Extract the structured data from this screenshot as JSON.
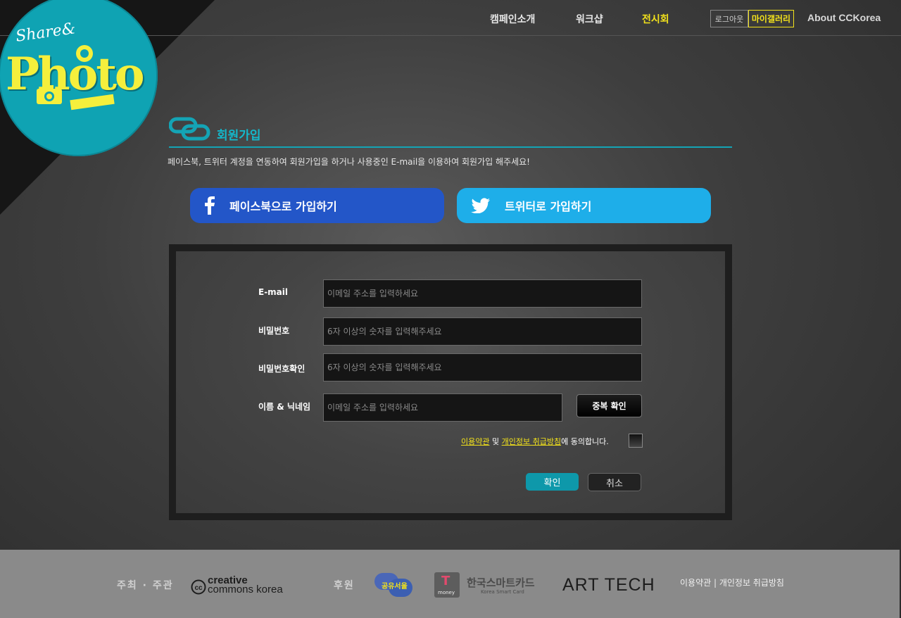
{
  "nav": {
    "items": [
      {
        "label": "캠페인소개",
        "active": false
      },
      {
        "label": "워크샵",
        "active": false
      },
      {
        "label": "전시회",
        "active": true
      }
    ],
    "logout_label": "로그아웃",
    "gallery_label": "마이갤러리",
    "about_label": "About CCKorea"
  },
  "logo": {
    "line1": "Share&",
    "line2": "Photo"
  },
  "signup": {
    "title": "회원가입",
    "intro": "페이스북, 트위터 계정을 연동하여 회원가입을 하거나 사용중인 E-mail을 이용하여 회원가입 해주세요!",
    "facebook_label": "페이스북으로 가입하기",
    "twitter_label": "트위터로 가입하기"
  },
  "form": {
    "email_label": "E-mail",
    "email_placeholder": "이메일 주소를 입력하세요",
    "password_label": "비밀번호",
    "password_placeholder": "6자 이상의 숫자를 입력해주세요",
    "password_confirm_label": "비밀번호확인",
    "password_confirm_placeholder": "6자 이상의 숫자를 입력해주세요",
    "name_label": "이름 & 닉네임",
    "name_placeholder": "이메일 주소를 입력하세요",
    "check_button": "중복 확인",
    "terms_link": "이용약관",
    "and_text": " 및 ",
    "privacy_link": "개인정보 취급방침",
    "agree_text": "에 동의합니다.",
    "ok_button": "확인",
    "cancel_button": "취소"
  },
  "footer": {
    "host_label": "주최 · 주관",
    "cc_logo_line1": "creative",
    "cc_logo_line2": "commons korea",
    "sponsor_label": "후원",
    "seoul_logo": "공유서울",
    "tmoney_logo_main": "한국스마트카드",
    "tmoney_logo_sub": "Korea Smart Card",
    "tmoney_badge": "money",
    "arttech_logo": "ART TECH",
    "links": "이용약관 | 개인정보 취급방침"
  },
  "colors": {
    "accent": "#14a4b5",
    "highlight": "#f3e21b",
    "facebook": "#2356c8",
    "twitter": "#1eaee9"
  }
}
